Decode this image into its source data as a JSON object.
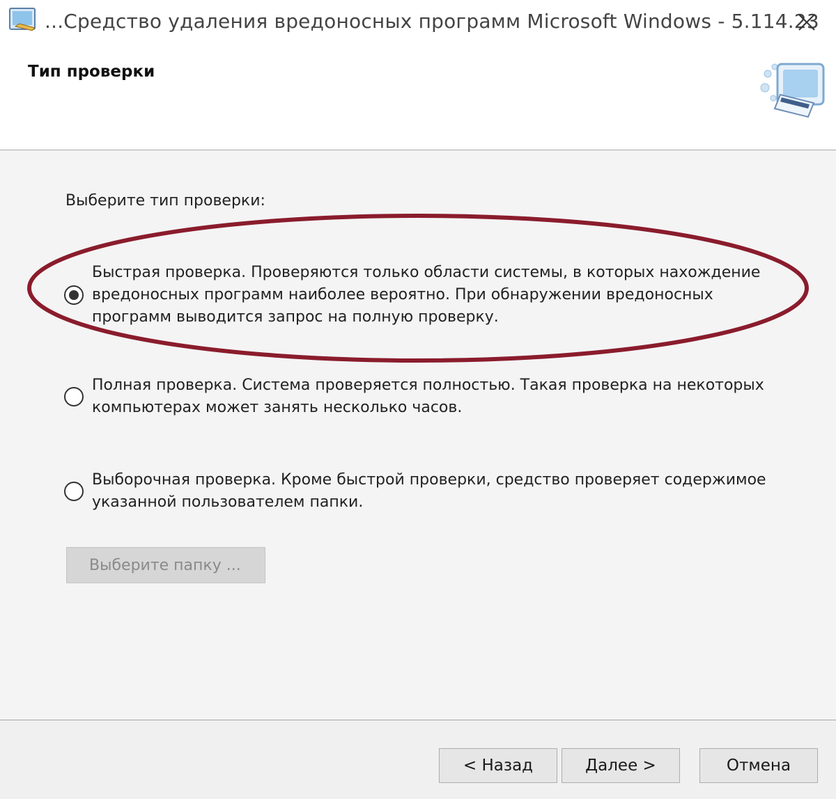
{
  "window": {
    "title": "...Средство удаления вредоносных программ Microsoft Windows -  5.114.23"
  },
  "header": {
    "title": "Тип проверки"
  },
  "main": {
    "prompt": "Выберите тип проверки:",
    "options": [
      {
        "text": "Быстрая проверка. Проверяются только области системы, в которых нахождение вредоносных программ наиболее вероятно. При обнаружении вредоносных программ выводится запрос на полную проверку.",
        "checked": true
      },
      {
        "text": "Полная проверка. Система проверяется полностью. Такая проверка на некоторых компьютерах может занять несколько часов.",
        "checked": false
      },
      {
        "text": "Выборочная проверка. Кроме быстрой проверки, средство проверяет содержимое указанной пользователем папки.",
        "checked": false
      }
    ],
    "choose_folder_label": "Выберите папку ..."
  },
  "footer": {
    "back_label": "< Назад",
    "next_label": "Далее >",
    "cancel_label": "Отмена"
  },
  "colors": {
    "highlight": "#8a1c2c"
  }
}
